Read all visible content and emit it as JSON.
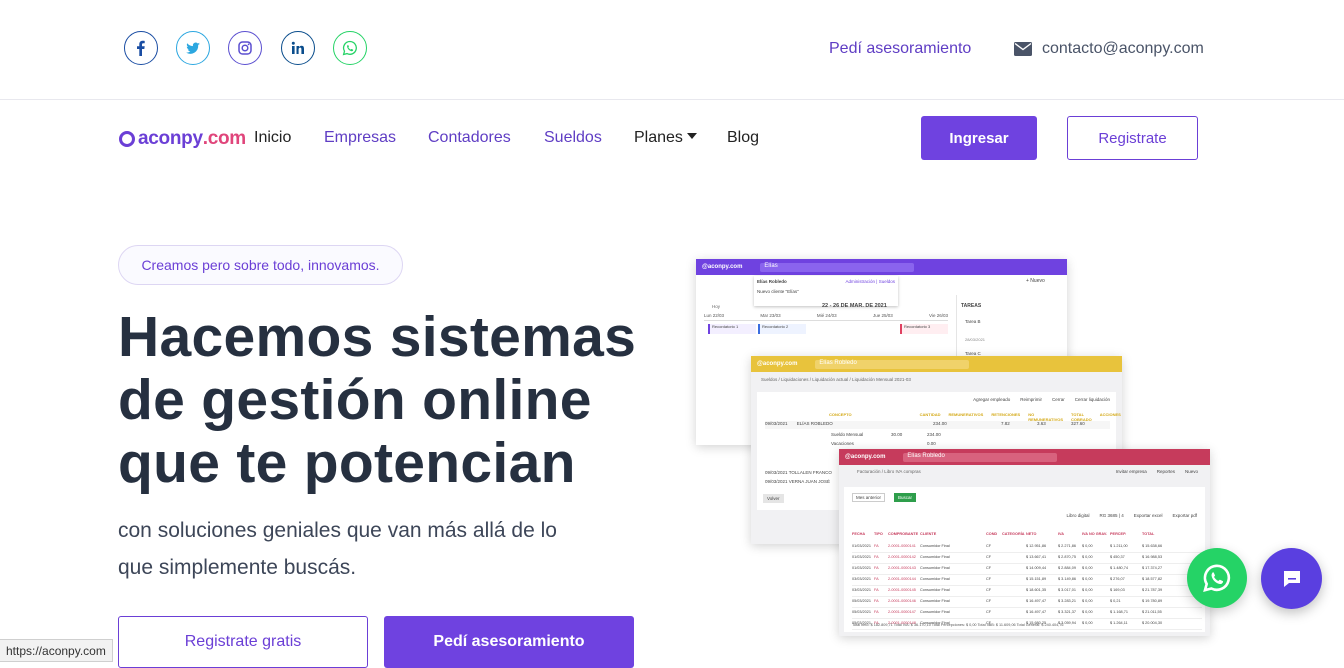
{
  "social": [
    {
      "name": "facebook",
      "icon": "facebook-icon",
      "color": "#1877f2"
    },
    {
      "name": "twitter",
      "icon": "twitter-icon",
      "color": "#1da1f2"
    },
    {
      "name": "instagram",
      "icon": "instagram-icon",
      "color": "#5b4fd0"
    },
    {
      "name": "linkedin",
      "icon": "linkedin-icon",
      "color": "#0a66c2"
    },
    {
      "name": "whatsapp",
      "icon": "whatsapp-icon",
      "color": "#25d366"
    }
  ],
  "topbar": {
    "advice_link": "Pedí asesoramiento",
    "email": "contacto@aconpy.com",
    "email_icon": "envelope-icon"
  },
  "logo": {
    "name": "aconpy",
    "domain": ".com"
  },
  "nav": {
    "items": [
      "Inicio",
      "Empresas",
      "Contadores",
      "Sueldos",
      "Planes",
      "Blog"
    ],
    "login": "Ingresar",
    "register": "Registrate"
  },
  "hero": {
    "tagline": "Creamos pero sobre todo, innovamos.",
    "title_lines": [
      "Hacemos sistemas",
      "de gestión online",
      "que te potencian"
    ],
    "subtitle_lines": [
      "con soluciones geniales que van más allá de lo",
      "que simplemente buscás."
    ],
    "cta_primary": "Registrate gratis",
    "cta_secondary": "Pedí asesoramiento"
  },
  "mockups": {
    "calendar": {
      "brand": "@aconpy.com",
      "search": "Elías",
      "title": "22 - 26 DE MAR. DE 2021",
      "tasks_header": "TAREAS",
      "new_label": "+ Nuevo",
      "result_name": "Elías Robledo",
      "result_meta": "Administración | Sueldos",
      "new_client": "Nuevo cliente \"Elías\"",
      "today": "Hoy",
      "days": [
        "Lun 22/03",
        "Mar 23/03",
        "Mié 24/03",
        "Jue 25/03",
        "Vie 26/03"
      ],
      "events": [
        "Recordatorio 1",
        "Recordatorio 2",
        "Recordatorio 3"
      ],
      "tasks": [
        "Tarea B",
        "Tarea C"
      ],
      "task_date": "28/03/2021"
    },
    "payroll": {
      "brand": "@aconpy.com",
      "search": "Elías Robledo",
      "breadcrumb": "Sueldos / Liquidaciones / Liquidación actual / Liquidación Mensual 2021-03",
      "actions": [
        "Agregar empleado",
        "Reimprimir",
        "Cerrar",
        "Cerrar liquidación"
      ],
      "columns": [
        "CONCEPTO",
        "CANTIDAD",
        "REMUNERATIVOS",
        "RETENCIONES",
        "NO REMUNERATIVOS",
        "TOTAL COBRADO",
        "ACCIONES"
      ],
      "employee_row": {
        "date": "09/03/2021",
        "name": "ELÍAS ROBLEDO",
        "values": [
          "234.00",
          "7.82",
          "3.63",
          "327.60"
        ]
      },
      "concepts": [
        {
          "name": "Sueldo Mensual",
          "qty": "30.00",
          "amount": "234.00"
        },
        {
          "name": "Vacaciones",
          "qty": "",
          "amount": "0.00"
        }
      ],
      "other_rows": [
        {
          "date": "09/03/2021",
          "name": "TOLLALEN FRANCO"
        },
        {
          "date": "09/03/2021",
          "name": "VERNA JUAN JOSÉ"
        }
      ],
      "footer_button": "Volver"
    },
    "invoices": {
      "brand": "@aconpy.com",
      "search": "Elías Robledo",
      "breadcrumb": "Facturación / Libro IVA compras",
      "actions": [
        "Invitar empresa",
        "Reportes",
        "Nuevo"
      ],
      "filter_label": "Mes anterior",
      "filter_button": "Buscar",
      "selects": [
        "Libro digital",
        "RG 3685 | 4",
        "Exportar excel",
        "Exportar pdf"
      ],
      "columns": [
        "FECHA",
        "TIPO",
        "COMPROBANTE",
        "CLIENTE",
        "COND",
        "CATEGORÍA",
        "NETO",
        "IVA",
        "IVA NO GRAV.",
        "PERCEP.",
        "TOTAL"
      ],
      "rows": [
        [
          "01/03/2021",
          "FA",
          "2-0001-0000141",
          "Consumidor Final",
          "CF",
          "",
          "$ 12.951,86",
          "$ 2.271,86",
          "$ 0,00",
          "$ 1.211,00",
          "$ 15.638,66"
        ],
        [
          "01/03/2021",
          "FA",
          "2-0001-0000142",
          "Consumidor Final",
          "CF",
          "",
          "$ 13.667,41",
          "$ 2.870,75",
          "$ 0,00",
          "$ 450,37",
          "$ 16.988,53"
        ],
        [
          "01/03/2021",
          "FA",
          "2-0001-0000143",
          "Consumidor Final",
          "CF",
          "",
          "$ 14.009,44",
          "$ 2.884,09",
          "$ 0,00",
          "$ 1.480,74",
          "$ 17.374,27"
        ],
        [
          "03/03/2021",
          "FA",
          "2-0001-0000144",
          "Consumidor Final",
          "CF",
          "",
          "$ 15.151,89",
          "$ 3.149,86",
          "$ 0,00",
          "$ 276,07",
          "$ 18.577,82"
        ],
        [
          "03/03/2021",
          "FA",
          "2-0001-0000145",
          "Consumidor Final",
          "CF",
          "",
          "$ 18.601,35",
          "$ 3.017,01",
          "$ 0,00",
          "$ 169,03",
          "$ 21.787,39"
        ],
        [
          "05/03/2021",
          "FA",
          "2-0001-0000146",
          "Consumidor Final",
          "CF",
          "",
          "$ 16.497,47",
          "$ 3.283,21",
          "$ 0,00",
          "$ 0,21",
          "$ 19.780,89"
        ],
        [
          "05/03/2021",
          "FA",
          "2-0001-0000147",
          "Consumidor Final",
          "CF",
          "",
          "$ 16.497,47",
          "$ 3.321,37",
          "$ 0,00",
          "$ 1.168,71",
          "$ 21.011,55"
        ],
        [
          "05/03/2021",
          "FA",
          "2-0001-0000148",
          "Consumidor Final",
          "CF",
          "",
          "$ 15.680,25",
          "$ 3.059,94",
          "$ 0,00",
          "$ 1.264,11",
          "$ 20.004,30"
        ]
      ],
      "totals": "Total neto: $ 182.809,71   Total IVA: $ 36.170,10   Total Percepciones: $ 0,00   Total IIBB: $ 11.609,06   Total General: $ 240.404,76"
    }
  },
  "status_url": "https://aconpy.com",
  "fabs": {
    "whatsapp": "whatsapp-icon",
    "chat": "chat-icon"
  },
  "colors": {
    "primary": "#6f42e0",
    "text": "#263040",
    "payroll_bar": "#e8c33c",
    "invoices_bar": "#c63b5c",
    "calendar_bar": "#6f42e0",
    "whatsapp": "#25d366"
  }
}
